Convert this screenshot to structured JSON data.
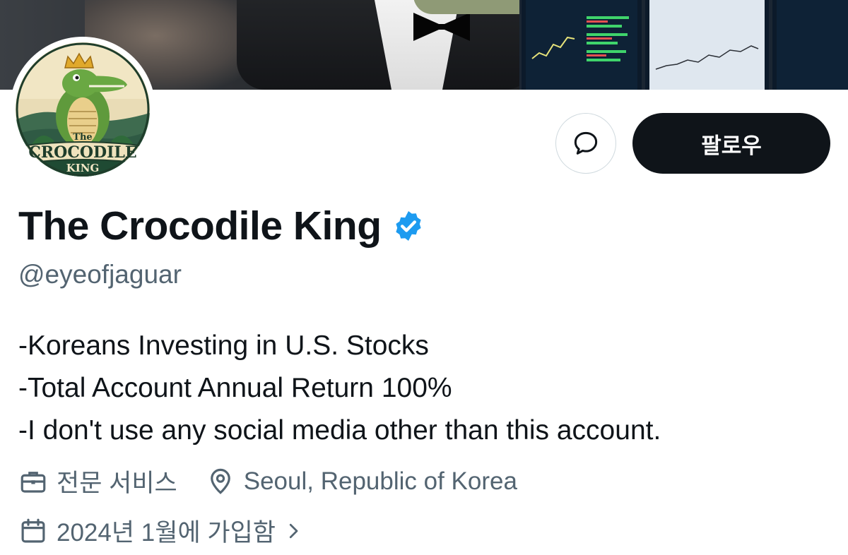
{
  "profile": {
    "display_name": "The Crocodile King",
    "handle": "@eyeofjaguar",
    "verified": true,
    "avatar_text": {
      "line1": "The",
      "line2": "CROCODILE",
      "line3": "KING"
    }
  },
  "actions": {
    "follow_label": "팔로우",
    "message_icon": "message-bubble-icon"
  },
  "bio": {
    "lines": [
      "-Koreans Investing in U.S. Stocks",
      "-Total Account Annual Return 100%",
      "-I don't use any social media other than this account."
    ]
  },
  "meta": {
    "category": "전문 서비스",
    "category_icon": "briefcase-icon",
    "location": "Seoul, Republic of Korea",
    "location_icon": "location-pin-icon",
    "joined": "2024년 1월에 가입함",
    "joined_icon": "calendar-icon",
    "joined_chevron_icon": "chevron-right-icon"
  },
  "colors": {
    "text_primary": "#0f1419",
    "text_secondary": "#536471",
    "verified_blue": "#1d9bf0",
    "follow_bg": "#0f1419",
    "follow_text": "#ffffff"
  }
}
